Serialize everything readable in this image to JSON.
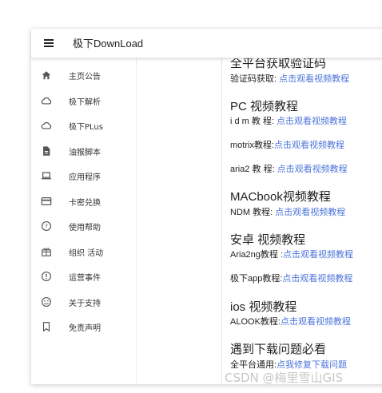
{
  "app": {
    "title": "极下DownLoad"
  },
  "sidebar": {
    "items": [
      {
        "label": "主页公告",
        "icon": "home-icon"
      },
      {
        "label": "极下解析",
        "icon": "cloud-icon"
      },
      {
        "label": "极下PLus",
        "icon": "cloud-icon"
      },
      {
        "label": "油猴脚本",
        "icon": "document-icon"
      },
      {
        "label": "应用程序",
        "icon": "laptop-icon"
      },
      {
        "label": "卡密兑换",
        "icon": "card-icon"
      },
      {
        "label": "使用帮助",
        "icon": "help-icon"
      },
      {
        "label": "组织 活动",
        "icon": "gift-icon"
      },
      {
        "label": "运营事件",
        "icon": "info-icon"
      },
      {
        "label": "关于支持",
        "icon": "smile-icon"
      },
      {
        "label": "免责声明",
        "icon": "bookmark-icon"
      }
    ]
  },
  "content": {
    "partial_heading": "全平台获取验证码",
    "captcha_prefix": "验证码获取: ",
    "link_text": "点击观看视频教程",
    "pc_heading": "PC 视频教程",
    "idm_prefix": "i d m 教 程: ",
    "motrix_prefix": "motrix教程:",
    "aria2_prefix": "aria2 教 程: ",
    "mac_heading": "MACbook视频教程",
    "ndm_prefix": "NDM 教程: ",
    "android_heading": "安卓 视频教程",
    "aria2ng_prefix": "Aria2ng教程 :",
    "jixia_app_prefix": "极下app教程:",
    "ios_heading": "ios 视频教程",
    "alook_prefix": "ALOOK教程:",
    "problem_heading": "遇到下载问题必看",
    "all_platform_prefix": "全平台通用:",
    "fix_link": "点我修复下载问题"
  },
  "watermark": "CSDN @梅里雪山GIS",
  "colors": {
    "link": "#4c74d9",
    "text": "#222222",
    "icon": "#555555"
  }
}
